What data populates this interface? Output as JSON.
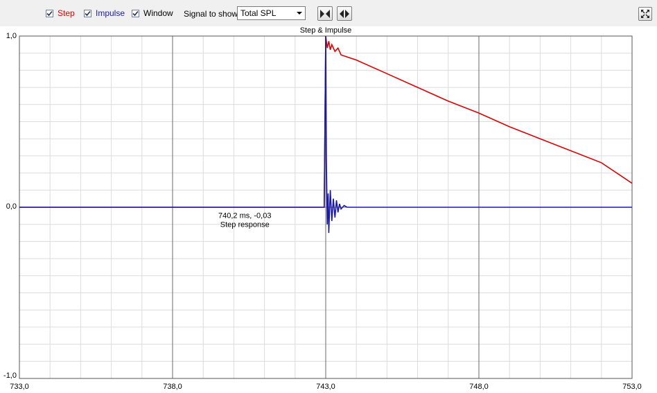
{
  "toolbar": {
    "checkboxes": [
      {
        "label": "Step",
        "checked": true,
        "color": "#e00000"
      },
      {
        "label": "Impulse",
        "checked": true,
        "color": "#1a1aa8"
      },
      {
        "label": "Window",
        "checked": true,
        "color": "#000000"
      }
    ],
    "signal_label": "Signal to show",
    "signal_value": "Total SPL",
    "buttons": [
      "zoom-in-icon",
      "zoom-out-icon"
    ],
    "fullscreen_icon": "maximize-icon"
  },
  "chart_data": {
    "type": "line",
    "title": "Step & Impulse",
    "xlim": [
      733,
      753
    ],
    "ylim": [
      -1,
      1
    ],
    "x_ticks": [
      733,
      738,
      743,
      748,
      753
    ],
    "x_tick_labels": [
      "733,0",
      "738,0",
      "743,0",
      "748,0",
      "753,0"
    ],
    "y_ticks": [
      -1,
      0,
      1
    ],
    "y_tick_labels": [
      "-1,0",
      "0,0",
      "1,0"
    ],
    "grid": true,
    "colors": {
      "step": "#e00000",
      "impulse": "#1a1aa8"
    },
    "series": [
      {
        "key": "step",
        "points": [
          [
            733,
            0
          ],
          [
            742.95,
            0
          ],
          [
            743.0,
            1.0
          ],
          [
            743.05,
            0.93
          ],
          [
            743.1,
            0.97
          ],
          [
            743.15,
            0.92
          ],
          [
            743.2,
            0.95
          ],
          [
            743.3,
            0.91
          ],
          [
            743.4,
            0.93
          ],
          [
            743.5,
            0.89
          ],
          [
            744,
            0.86
          ],
          [
            745,
            0.78
          ],
          [
            746,
            0.7
          ],
          [
            747,
            0.62
          ],
          [
            748,
            0.55
          ],
          [
            749,
            0.47
          ],
          [
            750,
            0.4
          ],
          [
            751,
            0.33
          ],
          [
            752,
            0.26
          ],
          [
            753,
            0.14
          ]
        ]
      },
      {
        "key": "impulse",
        "points": [
          [
            733,
            0
          ],
          [
            742.95,
            0
          ],
          [
            743.0,
            1.0
          ],
          [
            743.02,
            0.3
          ],
          [
            743.05,
            -0.1
          ],
          [
            743.08,
            0.08
          ],
          [
            743.1,
            -0.15
          ],
          [
            743.15,
            0.1
          ],
          [
            743.2,
            -0.08
          ],
          [
            743.25,
            0.05
          ],
          [
            743.3,
            -0.06
          ],
          [
            743.35,
            0.04
          ],
          [
            743.4,
            -0.03
          ],
          [
            743.45,
            0.02
          ],
          [
            743.5,
            -0.01
          ],
          [
            743.6,
            0.01
          ],
          [
            743.7,
            0
          ],
          [
            753,
            0
          ]
        ]
      }
    ],
    "annotation": {
      "x": 740.2,
      "y": -0.03,
      "lines": [
        "740,2 ms, -0,03",
        "Step response"
      ]
    }
  }
}
